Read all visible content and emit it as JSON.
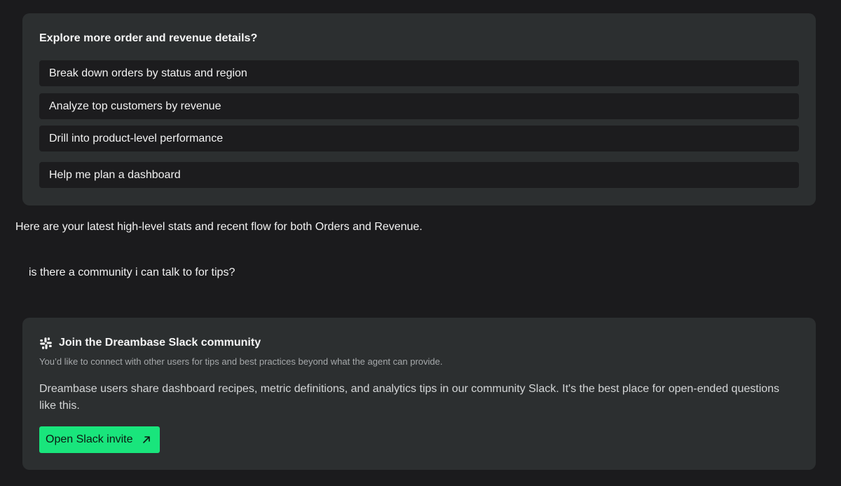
{
  "suggestions": {
    "title": "Explore more order and revenue details?",
    "items": [
      {
        "label": "Break down orders by status and region"
      },
      {
        "label": "Analyze top customers by revenue"
      },
      {
        "label": "Drill into product-level performance"
      },
      {
        "label": "Help me plan a dashboard"
      }
    ]
  },
  "chat": {
    "assistant_message": "Here are your latest high-level stats and recent flow for both Orders and Revenue.",
    "user_message": "is there a community i can talk to for tips?"
  },
  "slack_card": {
    "icon": "slack-icon",
    "title": "Join the Dreambase Slack community",
    "subtitle": "You’d like to connect with other users for tips and best practices beyond what the agent can provide.",
    "body": "Dreambase users share dashboard recipes, metric definitions, and analytics tips in our community Slack. It's the best place for open-ended questions like this.",
    "button_label": "Open Slack invite",
    "button_icon": "external-arrow-icon",
    "accent_color": "#19e57c"
  }
}
